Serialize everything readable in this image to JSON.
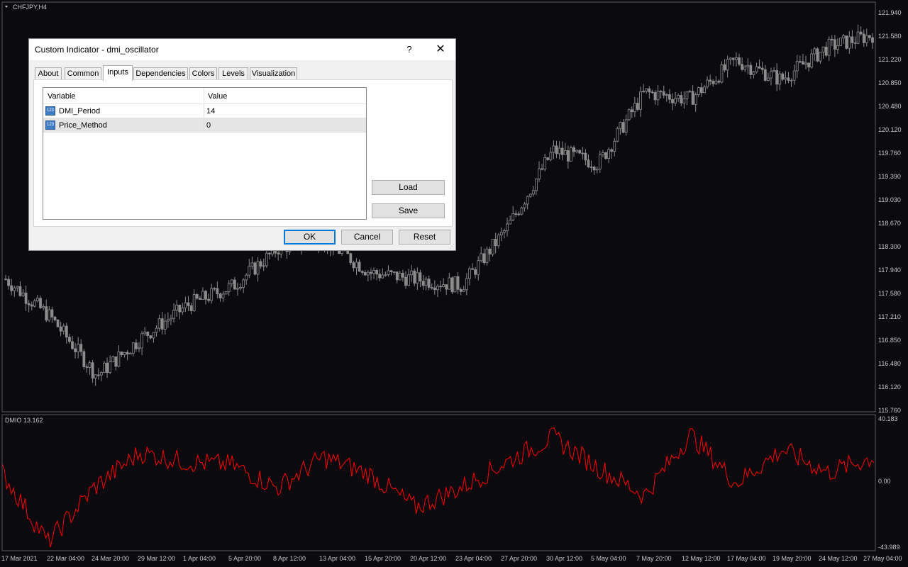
{
  "chart": {
    "symbol_label": "CHFJPY,H4",
    "indicator_label": "DMIO 13.162",
    "price_axis": [
      "121.940",
      "121.580",
      "121.220",
      "120.850",
      "120.480",
      "120.120",
      "119.760",
      "119.390",
      "119.030",
      "118.670",
      "118.300",
      "117.940",
      "117.580",
      "117.210",
      "116.850",
      "116.480",
      "116.120",
      "115.760"
    ],
    "indicator_axis": [
      "40.183",
      "0.00",
      "-43.989"
    ],
    "time_axis": [
      "17 Mar 2021",
      "22 Mar 04:00",
      "24 Mar 20:00",
      "29 Mar 12:00",
      "1 Apr 04:00",
      "5 Apr 20:00",
      "8 Apr 12:00",
      "13 Apr 04:00",
      "15 Apr 20:00",
      "20 Apr 12:00",
      "23 Apr 04:00",
      "27 Apr 20:00",
      "30 Apr 12:00",
      "5 May 04:00",
      "7 May 20:00",
      "12 May 12:00",
      "17 May 04:00",
      "19 May 20:00",
      "24 May 12:00",
      "27 May 04:00"
    ],
    "colors": {
      "background": "#0b0b0f",
      "candles": "#8c8c8c",
      "indicator_line": "#ff0000",
      "grid_border": "#5a5a5a"
    }
  },
  "chart_data": [
    {
      "type": "line",
      "title": "CHFJPY,H4",
      "ylim": [
        115.76,
        121.94
      ],
      "x": [
        "17 Mar 2021",
        "22 Mar 04:00",
        "24 Mar 20:00",
        "29 Mar 12:00",
        "1 Apr 04:00",
        "5 Apr 20:00",
        "8 Apr 12:00",
        "13 Apr 04:00",
        "15 Apr 20:00",
        "20 Apr 12:00",
        "23 Apr 04:00",
        "27 Apr 20:00",
        "30 Apr 12:00",
        "5 May 04:00",
        "7 May 20:00",
        "12 May 12:00",
        "17 May 04:00",
        "19 May 20:00",
        "24 May 12:00",
        "27 May 04:00"
      ],
      "series": [
        {
          "values": [
            117.7,
            117.3,
            116.2,
            116.6,
            117.3,
            117.6,
            118.4,
            118.5,
            118.0,
            117.8,
            117.6,
            118.5,
            119.8,
            119.6,
            120.7,
            120.5,
            121.1,
            120.8,
            121.5,
            121.6
          ]
        }
      ]
    },
    {
      "type": "line",
      "title": "DMIO 13.162",
      "ylim": [
        -43.989,
        40.183
      ],
      "x": [
        "17 Mar 2021",
        "22 Mar 04:00",
        "24 Mar 20:00",
        "29 Mar 12:00",
        "1 Apr 04:00",
        "5 Apr 20:00",
        "8 Apr 12:00",
        "13 Apr 04:00",
        "15 Apr 20:00",
        "20 Apr 12:00",
        "23 Apr 04:00",
        "27 Apr 20:00",
        "30 Apr 12:00",
        "5 May 04:00",
        "7 May 20:00",
        "12 May 12:00",
        "17 May 04:00",
        "19 May 20:00",
        "24 May 12:00",
        "27 May 04:00"
      ],
      "series": [
        {
          "values": [
            5,
            -41,
            -5,
            18,
            12,
            10,
            -5,
            15,
            4,
            -18,
            -5,
            12,
            28,
            8,
            -10,
            30,
            -2,
            20,
            5,
            15
          ]
        }
      ]
    }
  ],
  "dialog": {
    "title": "Custom Indicator - dmi_oscillator",
    "help": "?",
    "close": "✕",
    "tabs": [
      "About",
      "Common",
      "Inputs",
      "Dependencies",
      "Colors",
      "Levels",
      "Visualization"
    ],
    "active_tab": "Inputs",
    "grid": {
      "headers": {
        "variable": "Variable",
        "value": "Value"
      },
      "rows": [
        {
          "icon": "123",
          "variable": "DMI_Period",
          "value": "14"
        },
        {
          "icon": "123",
          "variable": "Price_Method",
          "value": "0"
        }
      ]
    },
    "buttons": {
      "load": "Load",
      "save": "Save",
      "ok": "OK",
      "cancel": "Cancel",
      "reset": "Reset"
    }
  }
}
